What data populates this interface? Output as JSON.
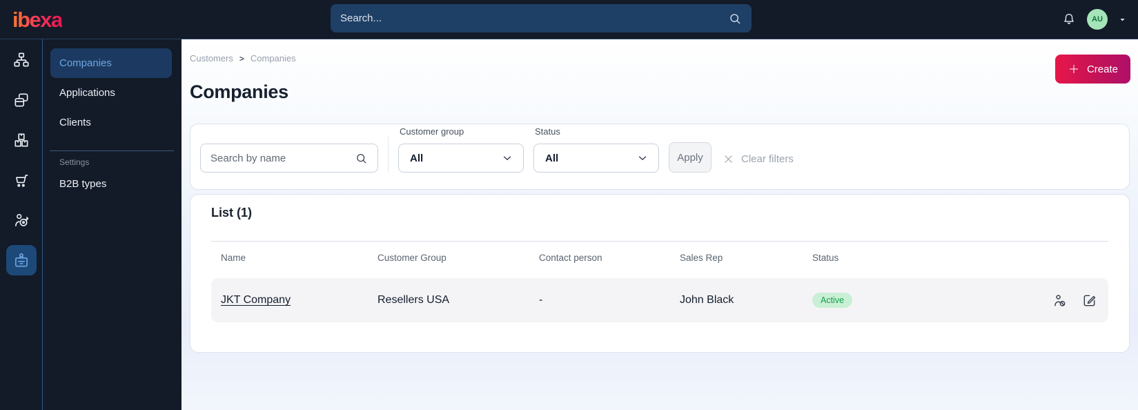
{
  "brand": {
    "logo_text": "ibexa"
  },
  "topbar": {
    "search_placeholder": "Search...",
    "avatar_initials": "AU"
  },
  "icon_rail": {
    "items": [
      "content-tree-icon",
      "pages-icon",
      "products-icon",
      "cart-icon",
      "personalization-icon",
      "customer-portal-icon"
    ],
    "active": "customer-portal-icon"
  },
  "sidebar": {
    "items": [
      {
        "label": "Companies",
        "active": true
      },
      {
        "label": "Applications",
        "active": false
      },
      {
        "label": "Clients",
        "active": false
      }
    ],
    "settings_label": "Settings",
    "settings_items": [
      {
        "label": "B2B types"
      }
    ]
  },
  "breadcrumb": {
    "items": [
      "Customers",
      "Companies"
    ],
    "separator": ">"
  },
  "page": {
    "title": "Companies",
    "create_label": "Create"
  },
  "filters": {
    "search_placeholder": "Search by name",
    "groups": [
      {
        "label": "Customer group",
        "value": "All"
      },
      {
        "label": "Status",
        "value": "All"
      }
    ],
    "apply_label": "Apply",
    "clear_label": "Clear filters"
  },
  "list": {
    "title": "List (1)",
    "columns": [
      "Name",
      "Customer Group",
      "Contact person",
      "Sales Rep",
      "Status"
    ],
    "rows": [
      {
        "name": "JKT Company",
        "customer_group": "Resellers USA",
        "contact_person": "-",
        "sales_rep": "John Black",
        "status": "Active"
      }
    ]
  },
  "colors": {
    "topbar_bg": "#131a28",
    "search_pill_bg": "#1f4066",
    "active_nav_bg": "#1c3a61",
    "active_nav_text": "#6ea5e3",
    "create_gradient_start": "#e7174a",
    "create_gradient_end": "#af1069",
    "badge_active_bg": "#c9efd5",
    "badge_active_text": "#12a14b",
    "avatar_bg": "#a4e4b8",
    "content_bg": "#edf2fb"
  }
}
